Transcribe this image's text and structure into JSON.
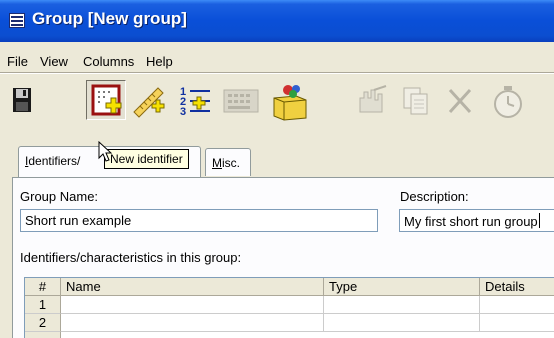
{
  "window": {
    "title": "Group [New group]"
  },
  "menu": [
    "File",
    "View",
    "Columns",
    "Help"
  ],
  "toolbar": {
    "buttons": [
      {
        "name": "save-icon"
      },
      {
        "name": "new-identifier-icon",
        "tooltip": "New identifier"
      },
      {
        "name": "new-characteristic-icon"
      },
      {
        "name": "numbered-list-icon"
      },
      {
        "name": "keypad-icon"
      },
      {
        "name": "package-icon"
      },
      {
        "name": "edit-hand-icon"
      },
      {
        "name": "copy-icon"
      },
      {
        "name": "delete-icon"
      },
      {
        "name": "timer-icon"
      }
    ]
  },
  "tooltip": {
    "text": "New identifier"
  },
  "tabs": [
    {
      "label_prefix": "I",
      "label_rest": "dentifiers/",
      "active": true
    },
    {
      "label_prefix": "M",
      "label_rest": "isc.",
      "active": false
    }
  ],
  "form": {
    "group_name_label": "Group Name:",
    "group_name_value": "Short run example",
    "description_label": "Description:",
    "description_value": "My first short run group",
    "grid_label": "Identifiers/characteristics in this group:"
  },
  "grid": {
    "columns": [
      "#",
      "Name",
      "Type",
      "Details"
    ],
    "rows": [
      "1",
      "2"
    ]
  }
}
